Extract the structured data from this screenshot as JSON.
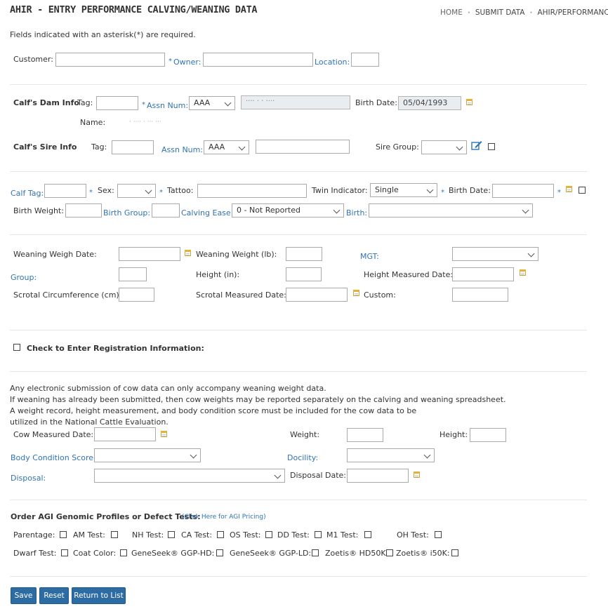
{
  "header": {
    "title": "AHIR - ENTRY PERFORMANCE CALVING/WEANING DATA",
    "breadcrumb": [
      "HOME",
      "SUBMIT DATA",
      "AHIR/PERFORMANCE"
    ]
  },
  "required_note": "Fields indicated with an asterisk(*) are required.",
  "owner_row": {
    "customer": "Customer:",
    "owner": "Owner:",
    "location": "Location:",
    "star": "*"
  },
  "dam": {
    "heading": "Calf's Dam Info",
    "tag": "Tag:",
    "assn_num": "Assn Num:",
    "assn_value": "AAA",
    "assn_readonly": "···· · · ····",
    "birth_date_label": "Birth Date:",
    "birth_date_value": "05/04/1993",
    "name_label": "Name:",
    "name_value": "· ···· · ··· ···"
  },
  "sire": {
    "heading": "Calf's Sire Info",
    "tag": "Tag:",
    "assn_num": "Assn Num:",
    "assn_value": "AAA",
    "sire_group": "Sire Group:"
  },
  "calf": {
    "calf_tag": "Calf Tag:",
    "sex": "Sex:",
    "tattoo": "Tattoo:",
    "twin_indicator": "Twin Indicator:",
    "twin_value": "Single",
    "birth_date": "Birth Date:",
    "birth_weight": "Birth Weight:",
    "birth_group": "Birth Group:",
    "calving_ease": "Calving Ease:",
    "calving_ease_value": "0 - Not Reported",
    "birth": "Birth:"
  },
  "weaning": {
    "weigh_date": "Weaning Weigh Date:",
    "weight": "Weaning Weight (lb):",
    "mgt": "MGT:",
    "group": "Group:",
    "height": "Height (in):",
    "height_date": "Height Measured Date:",
    "scrotal": "Scrotal Circumference (cm):",
    "scrotal_date": "Scrotal Measured Date:",
    "custom": "Custom:"
  },
  "registration": {
    "label": "Check to Enter Registration Information:"
  },
  "cow": {
    "notes": [
      "Any electronic submission of cow data can only accompany weaning weight data.",
      "If weaning has already been submitted, then cow weights may be reported separately on the calving and weaning spreadsheet.",
      "A weight record, height measurement, and body condition score must be included for the cow data to be",
      "utilized in the National Cattle Evaluation."
    ],
    "measured_date": "Cow Measured Date:",
    "weight": "Weight:",
    "height": "Height:",
    "bcs": "Body Condition Score:",
    "docility": "Docility:",
    "disposal": "Disposal:",
    "disposal_date": "Disposal Date:"
  },
  "genomic": {
    "heading": "Order AGI Genomic Profiles or Defect Tests:",
    "pricing_link": "(Click Here for AGI Pricing)",
    "row1": [
      "Parentage:",
      "AM Test:",
      "NH Test:",
      "CA Test:",
      "OS Test:",
      "DD Test:",
      "M1 Test:",
      "OH Test:"
    ],
    "row2": [
      "Dwarf Test:",
      "Coat Color:",
      "GeneSeek® GGP-HD:",
      "GeneSeek® GGP-LD:",
      "Zoetis® HD50K:",
      "Zoetis® i50K:"
    ]
  },
  "buttons": {
    "save": "Save",
    "reset": "Reset",
    "return": "Return to List"
  }
}
